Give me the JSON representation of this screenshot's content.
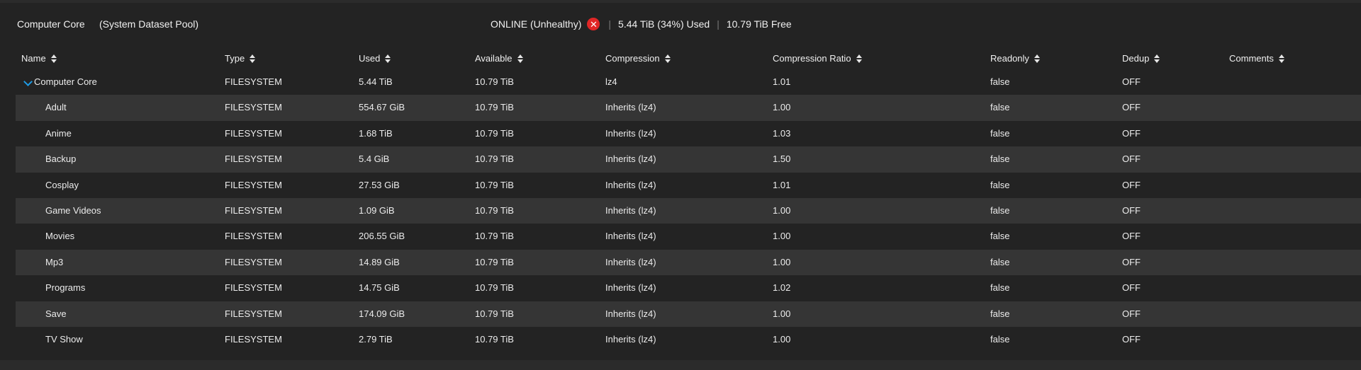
{
  "pool": {
    "name": "Computer Core",
    "subtitle": "(System Dataset Pool)",
    "status": "ONLINE (Unhealthy)",
    "status_icon": "error-circle-icon",
    "used": "5.44 TiB (34%) Used",
    "free": "10.79 TiB Free",
    "separator": "|"
  },
  "colors": {
    "background": "#232323",
    "alt_row": "#353535",
    "error": "#e02626",
    "accent": "#1e9be6"
  },
  "columns": [
    {
      "key": "name",
      "label": "Name"
    },
    {
      "key": "type",
      "label": "Type"
    },
    {
      "key": "used",
      "label": "Used"
    },
    {
      "key": "available",
      "label": "Available"
    },
    {
      "key": "compression",
      "label": "Compression"
    },
    {
      "key": "ratio",
      "label": "Compression Ratio"
    },
    {
      "key": "readonly",
      "label": "Readonly"
    },
    {
      "key": "dedup",
      "label": "Dedup"
    },
    {
      "key": "comments",
      "label": "Comments"
    }
  ],
  "rows": [
    {
      "name": "Computer Core",
      "type": "FILESYSTEM",
      "used": "5.44 TiB",
      "available": "10.79 TiB",
      "compression": "lz4",
      "ratio": "1.01",
      "readonly": "false",
      "dedup": "OFF",
      "comments": ""
    },
    {
      "name": "Adult",
      "type": "FILESYSTEM",
      "used": "554.67 GiB",
      "available": "10.79 TiB",
      "compression": "Inherits (lz4)",
      "ratio": "1.00",
      "readonly": "false",
      "dedup": "OFF",
      "comments": ""
    },
    {
      "name": "Anime",
      "type": "FILESYSTEM",
      "used": "1.68 TiB",
      "available": "10.79 TiB",
      "compression": "Inherits (lz4)",
      "ratio": "1.03",
      "readonly": "false",
      "dedup": "OFF",
      "comments": ""
    },
    {
      "name": "Backup",
      "type": "FILESYSTEM",
      "used": "5.4 GiB",
      "available": "10.79 TiB",
      "compression": "Inherits (lz4)",
      "ratio": "1.50",
      "readonly": "false",
      "dedup": "OFF",
      "comments": ""
    },
    {
      "name": "Cosplay",
      "type": "FILESYSTEM",
      "used": "27.53 GiB",
      "available": "10.79 TiB",
      "compression": "Inherits (lz4)",
      "ratio": "1.01",
      "readonly": "false",
      "dedup": "OFF",
      "comments": ""
    },
    {
      "name": "Game Videos",
      "type": "FILESYSTEM",
      "used": "1.09 GiB",
      "available": "10.79 TiB",
      "compression": "Inherits (lz4)",
      "ratio": "1.00",
      "readonly": "false",
      "dedup": "OFF",
      "comments": ""
    },
    {
      "name": "Movies",
      "type": "FILESYSTEM",
      "used": "206.55 GiB",
      "available": "10.79 TiB",
      "compression": "Inherits (lz4)",
      "ratio": "1.00",
      "readonly": "false",
      "dedup": "OFF",
      "comments": ""
    },
    {
      "name": "Mp3",
      "type": "FILESYSTEM",
      "used": "14.89 GiB",
      "available": "10.79 TiB",
      "compression": "Inherits (lz4)",
      "ratio": "1.00",
      "readonly": "false",
      "dedup": "OFF",
      "comments": ""
    },
    {
      "name": "Programs",
      "type": "FILESYSTEM",
      "used": "14.75 GiB",
      "available": "10.79 TiB",
      "compression": "Inherits (lz4)",
      "ratio": "1.02",
      "readonly": "false",
      "dedup": "OFF",
      "comments": ""
    },
    {
      "name": "Save",
      "type": "FILESYSTEM",
      "used": "174.09 GiB",
      "available": "10.79 TiB",
      "compression": "Inherits (lz4)",
      "ratio": "1.00",
      "readonly": "false",
      "dedup": "OFF",
      "comments": ""
    },
    {
      "name": "TV Show",
      "type": "FILESYSTEM",
      "used": "2.79 TiB",
      "available": "10.79 TiB",
      "compression": "Inherits (lz4)",
      "ratio": "1.00",
      "readonly": "false",
      "dedup": "OFF",
      "comments": ""
    }
  ]
}
